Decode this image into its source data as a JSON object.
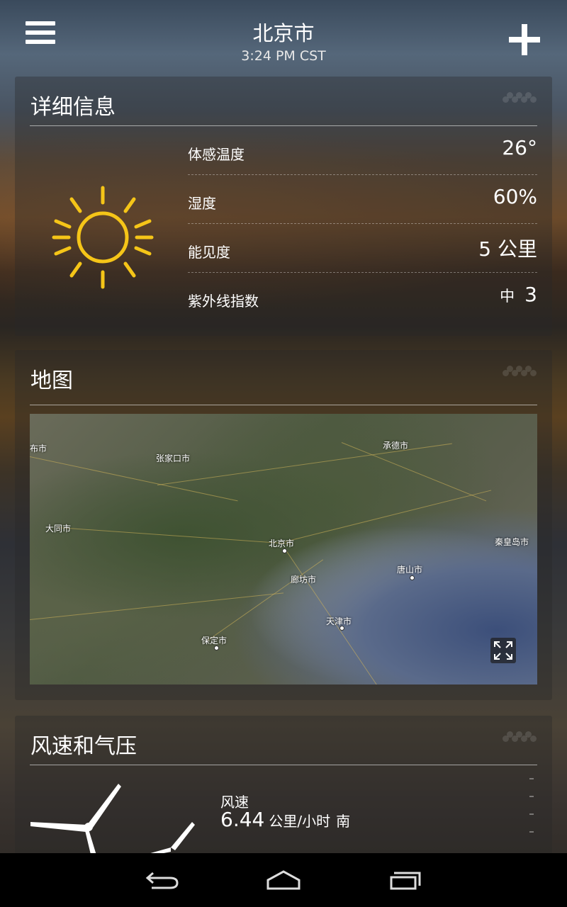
{
  "header": {
    "city": "北京市",
    "time": "3:24 PM CST",
    "menu_icon": "hamburger-menu-icon",
    "add_icon": "plus-icon"
  },
  "details": {
    "title": "详细信息",
    "icon": "sun-icon",
    "rows": [
      {
        "label": "体感温度",
        "value": "26°"
      },
      {
        "label": "湿度",
        "value": "60%"
      },
      {
        "label": "能见度",
        "value": "5",
        "unit": "公里"
      },
      {
        "label": "紫外线指数",
        "level": "中",
        "value": "3"
      }
    ]
  },
  "map": {
    "title": "地图",
    "labels": [
      "布市",
      "张家口市",
      "承德市",
      "大同市",
      "北京市",
      "秦皇岛市",
      "唐山市",
      "廊坊市",
      "天津市",
      "保定市"
    ],
    "expand_icon": "fullscreen-expand-icon"
  },
  "wind": {
    "title": "风速和气压",
    "icon": "wind-turbine-icon",
    "speed_label": "风速",
    "speed_value": "6.44",
    "speed_unit": "公里/小时",
    "direction": "南"
  },
  "navbar": {
    "back_icon": "back-icon",
    "home_icon": "home-icon",
    "recents_icon": "recent-apps-icon"
  },
  "colors": {
    "sun": "#f5c518",
    "accent_text": "#ffffff"
  }
}
